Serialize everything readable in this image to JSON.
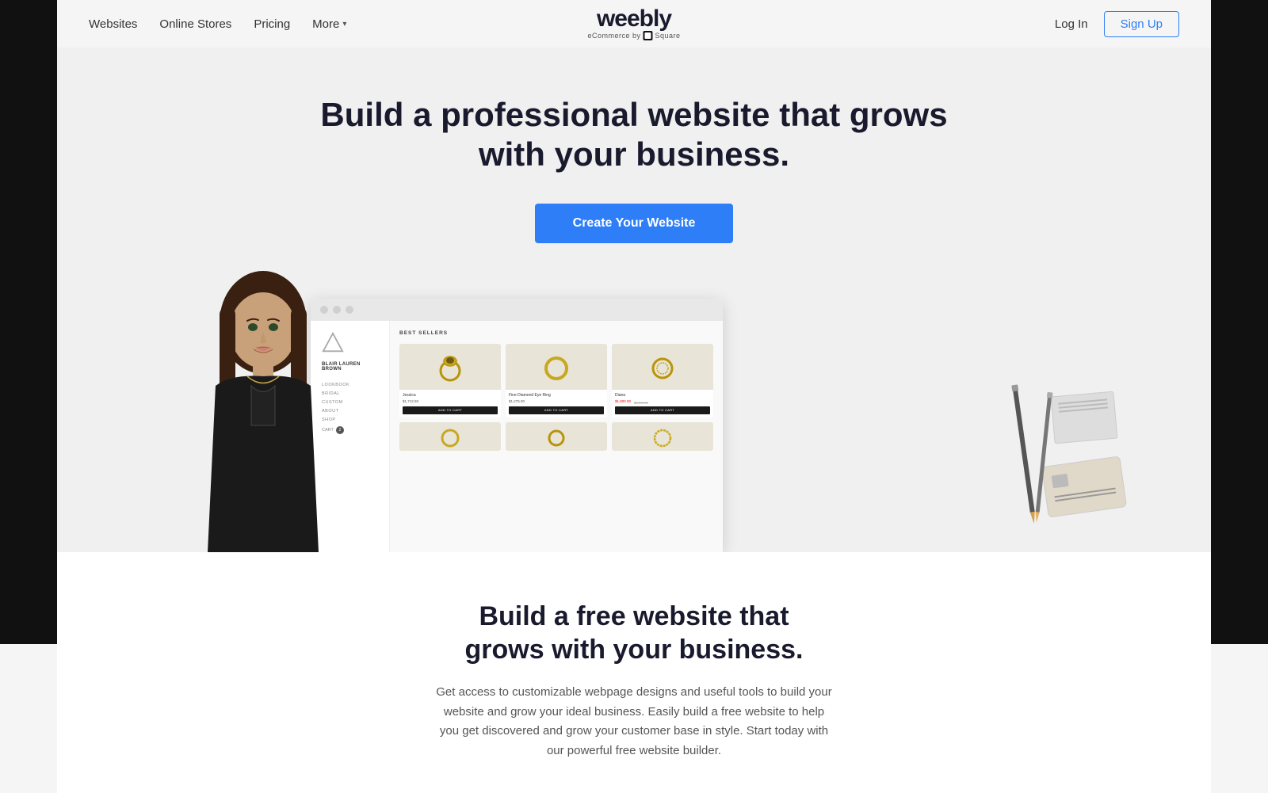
{
  "sidebar": {
    "colors": {
      "left": "#111",
      "right": "#111"
    }
  },
  "navbar": {
    "logo_text": "weebly",
    "logo_sub": "eCommerce by",
    "logo_square": "Square",
    "items": [
      {
        "label": "Websites",
        "id": "websites"
      },
      {
        "label": "Online Stores",
        "id": "online-stores"
      },
      {
        "label": "Pricing",
        "id": "pricing"
      },
      {
        "label": "More",
        "id": "more",
        "has_chevron": true
      }
    ],
    "login_label": "Log In",
    "signup_label": "Sign Up"
  },
  "hero": {
    "title_line1": "Build a professional website that grows",
    "title_line2": "with your business.",
    "cta_label": "Create Your Website"
  },
  "mockup": {
    "titlebar_dots": [
      "dot1",
      "dot2",
      "dot3"
    ],
    "sidebar": {
      "brand": "BLAIR LAUREN BROWN",
      "nav_items": [
        "LOOKBOOK",
        "BRIDAL",
        "CUSTOM",
        "ABOUT",
        "SHOP"
      ],
      "cart_label": "CART",
      "cart_count": "2"
    },
    "content": {
      "section_title": "BEST SELLERS",
      "products": [
        {
          "name": "Jessica",
          "price": "$1,712.50",
          "btn": "ADD TO CART"
        },
        {
          "name": "Fine Diamond Eye Ring",
          "price": "$1,275.00",
          "btn": "ADD TO CART"
        },
        {
          "name": "Diana",
          "price_sale": "$1,900.00",
          "price_original": "$3,299.00",
          "btn": "ADD TO CART"
        }
      ]
    }
  },
  "lower": {
    "title_line1": "Build a free website that",
    "title_line2": "grows with your business.",
    "description": "Get access to customizable webpage designs and useful tools to build your website and grow your ideal business. Easily build a free website to help you get discovered and grow your customer base in style. Start today with our powerful free website builder."
  }
}
